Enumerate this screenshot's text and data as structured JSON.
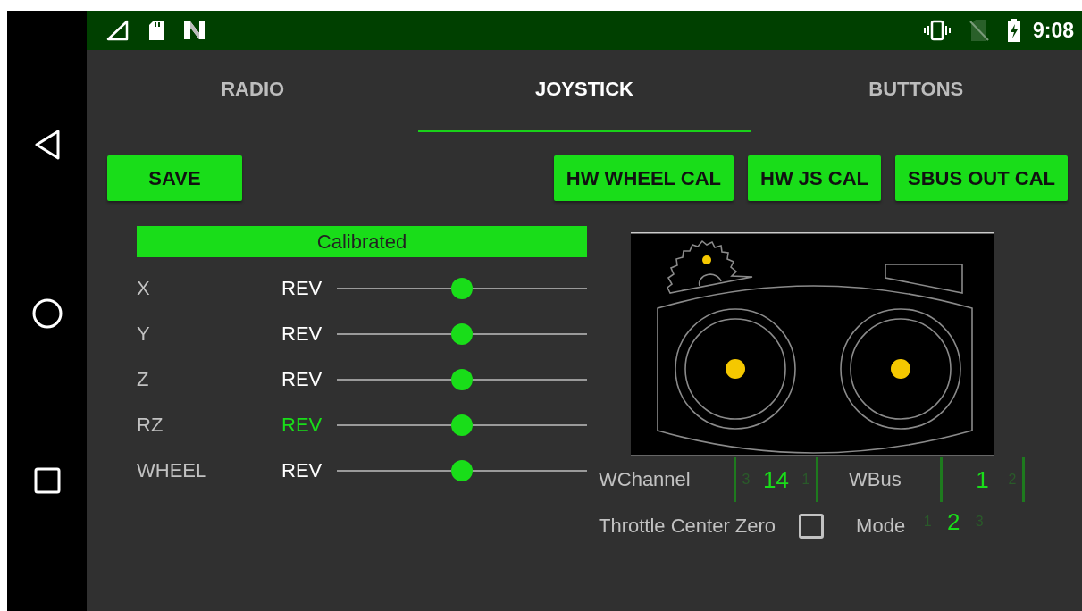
{
  "status_bar": {
    "time": "9:08"
  },
  "tabs": [
    {
      "label": "RADIO",
      "selected": false
    },
    {
      "label": "JOYSTICK",
      "selected": true
    },
    {
      "label": "BUTTONS",
      "selected": false
    }
  ],
  "action_buttons": [
    {
      "label": "SAVE"
    },
    {
      "label": "HW WHEEL CAL"
    },
    {
      "label": "HW JS CAL"
    },
    {
      "label": "SBUS OUT CAL"
    }
  ],
  "calibration_status": "Calibrated",
  "axes": [
    {
      "name": "X",
      "reverse_label": "REV",
      "reversed": false,
      "level": 0.5
    },
    {
      "name": "Y",
      "reverse_label": "REV",
      "reversed": false,
      "level": 0.5
    },
    {
      "name": "Z",
      "reverse_label": "REV",
      "reversed": false,
      "level": 0.5
    },
    {
      "name": "RZ",
      "reverse_label": "REV",
      "reversed": true,
      "level": 0.5
    },
    {
      "name": "WHEEL",
      "reverse_label": "REV",
      "reversed": false,
      "level": 0.5
    }
  ],
  "wheel_channel": {
    "label": "WChannel",
    "picker": {
      "previous": "3",
      "value": "14",
      "next": "1"
    }
  },
  "wheel_bus": {
    "label": "WBus",
    "picker": {
      "value": "1",
      "next": "2"
    }
  },
  "throttle_center_zero": {
    "label": "Throttle Center Zero",
    "checked": false
  },
  "mode": {
    "label": "Mode",
    "picker": {
      "previous": "1",
      "value": "2",
      "next": "3"
    }
  }
}
